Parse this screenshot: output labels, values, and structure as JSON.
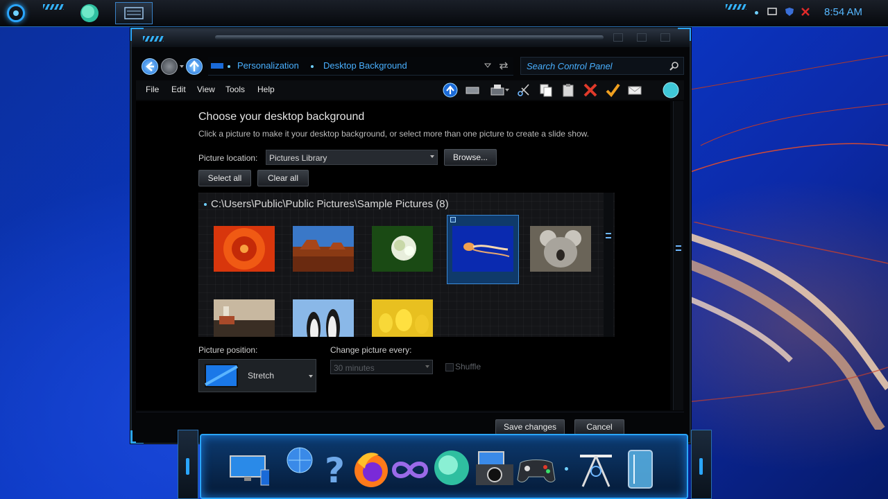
{
  "taskbar": {
    "clock": "8:54 AM"
  },
  "window": {
    "address": {
      "crumbs": [
        "Personalization",
        "Desktop Background"
      ],
      "search_placeholder": "Search Control Panel"
    },
    "menu": [
      "File",
      "Edit",
      "View",
      "Tools",
      "Help"
    ],
    "page": {
      "title": "Choose your desktop background",
      "subtitle": "Click a picture to make it your desktop background, or select more than one picture to create a slide show.",
      "location_label": "Picture location:",
      "location_value": "Pictures Library",
      "browse_label": "Browse...",
      "select_all_label": "Select all",
      "clear_all_label": "Clear all",
      "gallery_title": "C:\\Users\\Public\\Public Pictures\\Sample Pictures (8)",
      "position_label": "Picture position:",
      "position_value": "Stretch",
      "interval_label": "Change picture every:",
      "interval_value": "30 minutes",
      "shuffle_label": "Shuffle",
      "save_label": "Save changes",
      "cancel_label": "Cancel"
    },
    "pictures": [
      "chrysanthemum",
      "desert",
      "hydrangeas",
      "jellyfish",
      "koala",
      "lighthouse",
      "penguins",
      "tulips"
    ],
    "selected_picture": "jellyfish"
  },
  "colors": {
    "accent": "#2aa6ff",
    "link": "#49b0ff"
  }
}
